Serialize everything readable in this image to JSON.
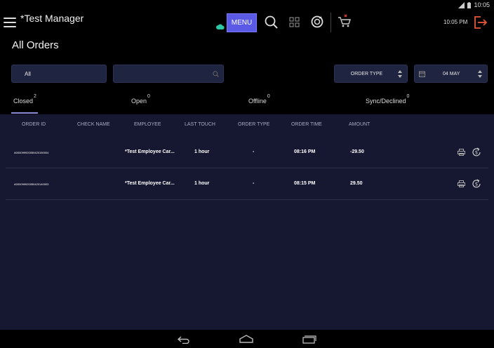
{
  "status_bar": {
    "time": "10:05"
  },
  "app": {
    "title": "*Test Manager",
    "menu_label": "MENU",
    "clock": "10:05 PM"
  },
  "page": {
    "title": "All Orders"
  },
  "filters": {
    "status_selected": "All",
    "search_value": "",
    "order_type_label": "ORDER TYPE",
    "date_label": "04 MAY"
  },
  "tabs": [
    {
      "label": "Closed",
      "count": "2"
    },
    {
      "label": "Open",
      "count": "0"
    },
    {
      "label": "Offline",
      "count": "0"
    },
    {
      "label": "Sync/Declined",
      "count": "0"
    }
  ],
  "table": {
    "columns": [
      "ORDER ID",
      "CHECK NAME",
      "EMPLOYEE",
      "LAST TOUCH",
      "ORDER TYPE",
      "ORDER TIME",
      "AMOUNT"
    ],
    "rows": [
      {
        "order_id": "A00009992005042015000­4",
        "check_name": "",
        "employee": "*Test Employee Car...",
        "last_touch": "1 hour",
        "order_type": "-",
        "order_time": "08:16 PM",
        "amount": "-29.50"
      },
      {
        "order_id": "A0000999200504201400­03",
        "check_name": "",
        "employee": "*Test Employee Car...",
        "last_touch": "1 hour",
        "order_type": "-",
        "order_time": "08:15 PM",
        "amount": "29.50"
      }
    ]
  },
  "colors": {
    "accent": "#5a5ae6",
    "panel": "#151830",
    "logout": "#e8563a",
    "cloud": "#2ec7a6",
    "cart_badge": "#e04040"
  }
}
